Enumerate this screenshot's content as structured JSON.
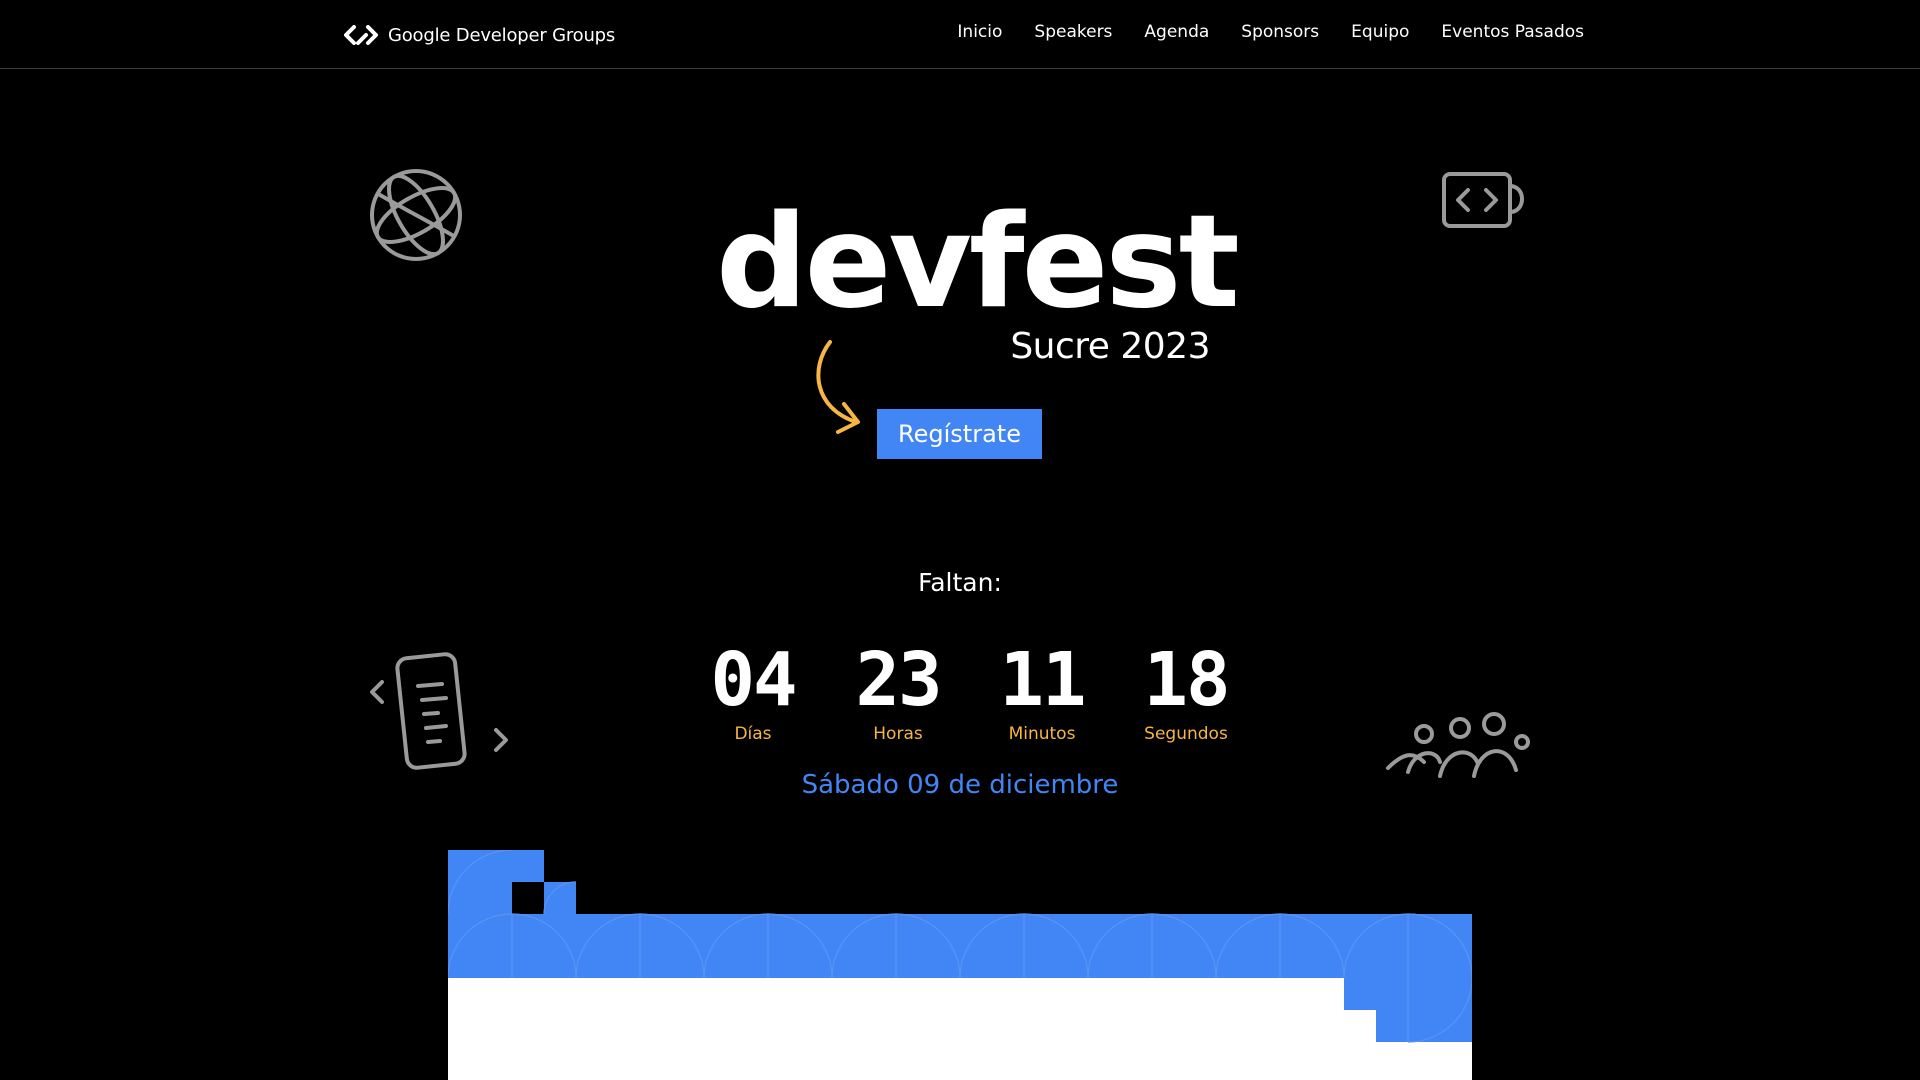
{
  "nav": {
    "brand": "Google Developer Groups",
    "links": [
      "Inicio",
      "Speakers",
      "Agenda",
      "Sponsors",
      "Equipo",
      "Eventos Pasados"
    ]
  },
  "hero": {
    "title": "devfest",
    "subtitle": "Sucre 2023",
    "register_label": "Regístrate",
    "countdown_heading": "Faltan:",
    "countdown": [
      {
        "value": "04",
        "label": "Días"
      },
      {
        "value": "23",
        "label": "Horas"
      },
      {
        "value": "11",
        "label": "Minutos"
      },
      {
        "value": "18",
        "label": "Segundos"
      }
    ],
    "date": "Sábado 09 de diciembre"
  },
  "colors": {
    "background": "#000000",
    "accent_blue": "#4285f4",
    "accent_yellow": "#f7b643",
    "text": "#ffffff",
    "doodle_gray": "#9a9a9a"
  },
  "icons": [
    "gdg-logo-icon",
    "globe-doodle-icon",
    "code-mug-doodle-icon",
    "arrow-doodle-icon",
    "phone-doodle-icon",
    "people-doodle-icon"
  ]
}
